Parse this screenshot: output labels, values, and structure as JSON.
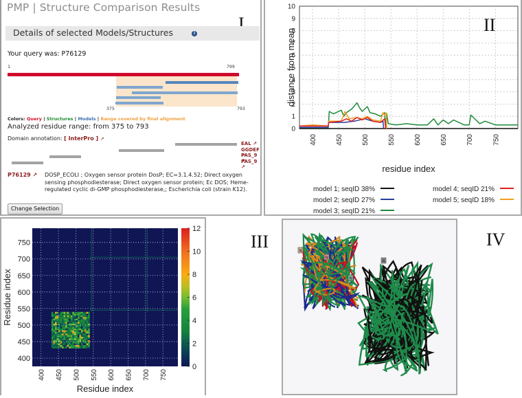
{
  "panel_labels": {
    "p1": "I",
    "p2": "II",
    "p3": "III",
    "p4": "IV"
  },
  "panel1": {
    "title": "PMP | Structure Comparison Results",
    "subheader": "Details of selected Models/Structures",
    "info_icon": "i",
    "query_text": "Your query was: P76129",
    "seq_start": "1",
    "seq_end": "799",
    "range_start_label": "375",
    "range_end_label": "793",
    "colors_legend": {
      "prefix": "Colors: ",
      "query": "Query",
      "sep1": " | ",
      "structures": "Structures",
      "sep2": " |  ",
      "models": "Models",
      "sep3": " | ",
      "range": "Range covered by final alignment",
      "query_color": "#d0102a",
      "structures_color": "#1e8a2e",
      "models_color": "#3d6fb0",
      "range_color": "#f0a040"
    },
    "analyzed_range": "Analyzed residue range: from 375 to 793",
    "domain_annotation_label": "Domain annotation: ",
    "domain_annotation_link": "[ InterPro ]",
    "domains": [
      {
        "label": "EAL ↗",
        "start": 578,
        "end": 793
      },
      {
        "label": "GGDEF ↗",
        "start": 385,
        "end": 540
      },
      {
        "label": "PAS_9 ↗",
        "start": 145,
        "end": 255
      },
      {
        "label": "PAS_9 ↗",
        "start": 15,
        "end": 123
      }
    ],
    "models_ranges": [
      {
        "start": 545,
        "end": 797,
        "style": "dark"
      },
      {
        "start": 378,
        "end": 535,
        "style": "light"
      },
      {
        "start": 430,
        "end": 795,
        "style": "light"
      },
      {
        "start": 375,
        "end": 530,
        "style": "light"
      },
      {
        "start": 372,
        "end": 538,
        "style": "light"
      }
    ],
    "range": {
      "start": 375,
      "end": 793,
      "total": 799
    },
    "entry_accession": "P76129 ↗",
    "entry_description": "DOSP_ECOLI ; Oxygen sensor protein DosP; EC=3.1.4.52; Direct oxygen sensing phosphodiesterase; Direct oxygen sensor protein; Ec DOS; Heme-regulated cyclic di-GMP phosphodiesterase,; Escherichia coli (strain K12).",
    "change_selection_button": "Change Selection"
  },
  "chart_data": [
    {
      "type": "line",
      "title": "",
      "xlabel": "residue index",
      "ylabel": "distance from mean",
      "xlim": [
        375,
        793
      ],
      "ylim": [
        0,
        10
      ],
      "xticks": [
        400,
        450,
        500,
        550,
        600,
        650,
        700,
        750
      ],
      "yticks": [
        0,
        1,
        2,
        3,
        4,
        5,
        6,
        7,
        8,
        9,
        10
      ],
      "grid": true,
      "legend_position": "bottom",
      "series": [
        {
          "name": "model  1; seqID  38%",
          "color": "#111111",
          "x": [
            375,
            430,
            500,
            540,
            545,
            793
          ],
          "y": [
            0,
            0,
            0,
            0,
            0,
            0
          ]
        },
        {
          "name": "model  2; seqID  27%",
          "color": "#2b3f9a",
          "x": [
            375,
            430,
            431,
            460,
            480,
            500,
            515,
            530,
            535,
            536
          ],
          "y": [
            0.1,
            0.1,
            0.5,
            0.5,
            0.6,
            0.8,
            0.6,
            0.5,
            0.6,
            0
          ]
        },
        {
          "name": "model  3; seqID  21%",
          "color": "#1f8a3a",
          "x": [
            375,
            430,
            432,
            440,
            455,
            460,
            465,
            475,
            485,
            490,
            495,
            505,
            510,
            520,
            530,
            538,
            540,
            542,
            545,
            560,
            580,
            600,
            620,
            632,
            640,
            650,
            660,
            670,
            690,
            700,
            703,
            708,
            720,
            730,
            750,
            770,
            793
          ],
          "y": [
            0,
            0,
            1.4,
            1.2,
            1.5,
            1.0,
            1.3,
            1.6,
            2.1,
            1.7,
            1.4,
            1.8,
            1.3,
            1.2,
            1.0,
            1.3,
            0,
            1.2,
            0.4,
            0.3,
            0.4,
            0.3,
            0.3,
            0.8,
            0.3,
            0.7,
            0.4,
            0.7,
            0.3,
            0.3,
            1.1,
            0.9,
            0.4,
            0.6,
            0.3,
            0.3,
            0.3
          ]
        },
        {
          "name": "model  4; seqID  21%",
          "color": "#e02020",
          "x": [
            375,
            430,
            431,
            455,
            465,
            475,
            485,
            495,
            505,
            515,
            530,
            538,
            540
          ],
          "y": [
            0.2,
            0.2,
            0.5,
            0.6,
            0.8,
            0.6,
            0.9,
            0.7,
            0.9,
            0.6,
            0.5,
            0.8,
            0
          ]
        },
        {
          "name": "model  5; seqID  18%",
          "color": "#f0a020",
          "x": [
            375,
            400,
            430,
            431,
            455,
            462,
            470,
            485,
            495,
            505,
            515,
            530,
            535,
            538,
            541,
            542
          ],
          "y": [
            0.2,
            0.3,
            0.2,
            0.6,
            0.6,
            1.4,
            0.8,
            0.9,
            0.8,
            1.0,
            0.7,
            0.6,
            1.3,
            1.1,
            1.3,
            0
          ]
        }
      ]
    },
    {
      "type": "heatmap",
      "title": "",
      "xlabel": "Residue index",
      "ylabel": "Residue index",
      "xlim": [
        375,
        793
      ],
      "ylim": [
        375,
        793
      ],
      "xticks": [
        400,
        450,
        500,
        550,
        600,
        650,
        700,
        750
      ],
      "yticks": [
        400,
        450,
        500,
        550,
        600,
        650,
        700,
        750
      ],
      "colorbar": {
        "min": 0,
        "max": 12,
        "ticks": [
          0,
          2,
          4,
          6,
          8,
          10,
          12
        ]
      },
      "grid": true,
      "regions": [
        {
          "name": "high-variability block",
          "x": [
            430,
            540
          ],
          "y": [
            430,
            540
          ],
          "value_range": [
            2,
            10
          ]
        },
        {
          "name": "cross-band row",
          "y": 545,
          "x": [
            540,
            793
          ],
          "value": 2
        },
        {
          "name": "cross-band row",
          "y": 705,
          "x": [
            540,
            793
          ],
          "value": 2
        },
        {
          "name": "cross-band column",
          "x": 545,
          "y": [
            540,
            793
          ],
          "value": 2
        },
        {
          "name": "cross-band column",
          "x": 705,
          "y": [
            540,
            793
          ],
          "value": 2
        }
      ]
    }
  ],
  "panel4": {
    "description": "3D superposition of structures/models",
    "terminus_markers": [
      "N",
      "N",
      "N",
      "N"
    ]
  }
}
